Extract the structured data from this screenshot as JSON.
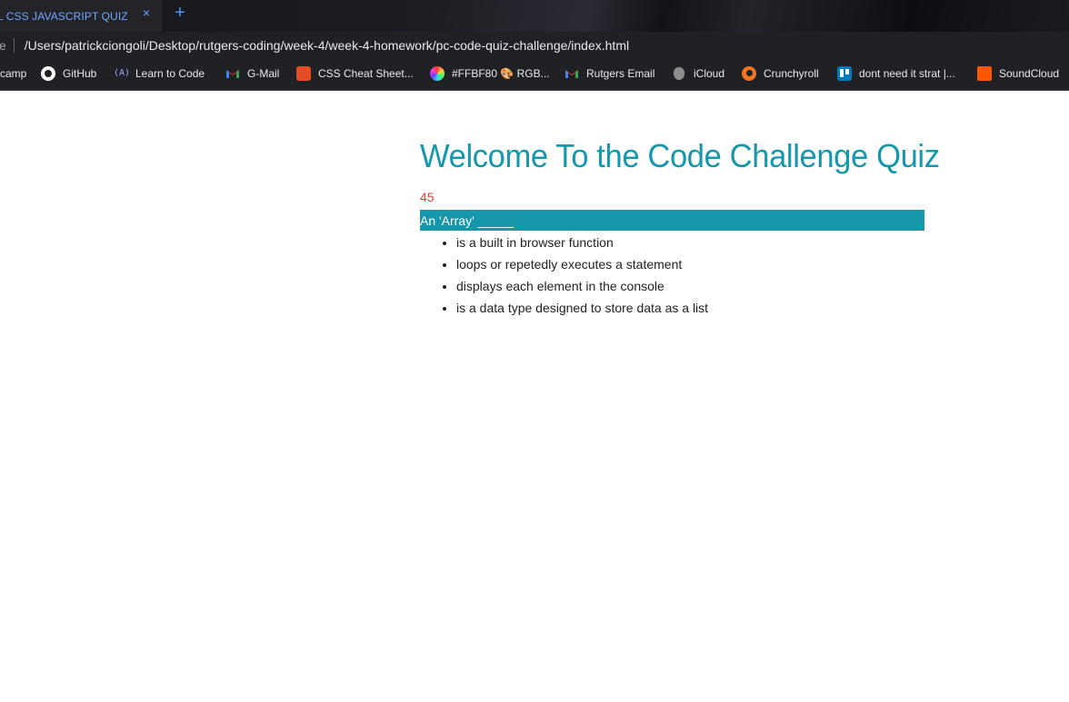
{
  "browser": {
    "tab": {
      "title": "L CSS JAVASCRIPT QUIZ",
      "close": "×"
    },
    "new_tab": "+",
    "address": {
      "prefix": "e",
      "url": "/Users/patrickciongoli/Desktop/rutgers-coding/week-4/week-4-homework/pc-code-quiz-challenge/index.html"
    },
    "bookmarks": [
      {
        "label": "camp",
        "icon": "none"
      },
      {
        "label": "GitHub",
        "icon": "github-icon"
      },
      {
        "label": "Learn to Code",
        "icon": "learn-to-code-icon",
        "glyph": "(A)"
      },
      {
        "label": "G-Mail",
        "icon": "gmail-icon"
      },
      {
        "label": "CSS Cheat Sheet...",
        "icon": "css-cheat-sheet-icon"
      },
      {
        "label": "#FFBF80 🎨 RGB...",
        "icon": "color-picker-icon"
      },
      {
        "label": "Rutgers Email",
        "icon": "gmail-icon"
      },
      {
        "label": "iCloud",
        "icon": "apple-icon"
      },
      {
        "label": "Crunchyroll",
        "icon": "crunchyroll-icon"
      },
      {
        "label": "dont need it strat |...",
        "icon": "trello-icon"
      },
      {
        "label": "SoundCloud",
        "icon": "soundcloud-icon"
      }
    ]
  },
  "colors": {
    "accent": "#1797ab",
    "timer": "#d9403a",
    "tab_text": "#6fa8ff"
  },
  "quiz": {
    "title": "Welcome To the Code Challenge Quiz",
    "timer": "45",
    "question": "An 'Array' _____",
    "answers": [
      "is a built in browser function",
      "loops or repetedly executes a statement",
      "displays each element in the console",
      "is a data type designed to store data as a list"
    ]
  }
}
